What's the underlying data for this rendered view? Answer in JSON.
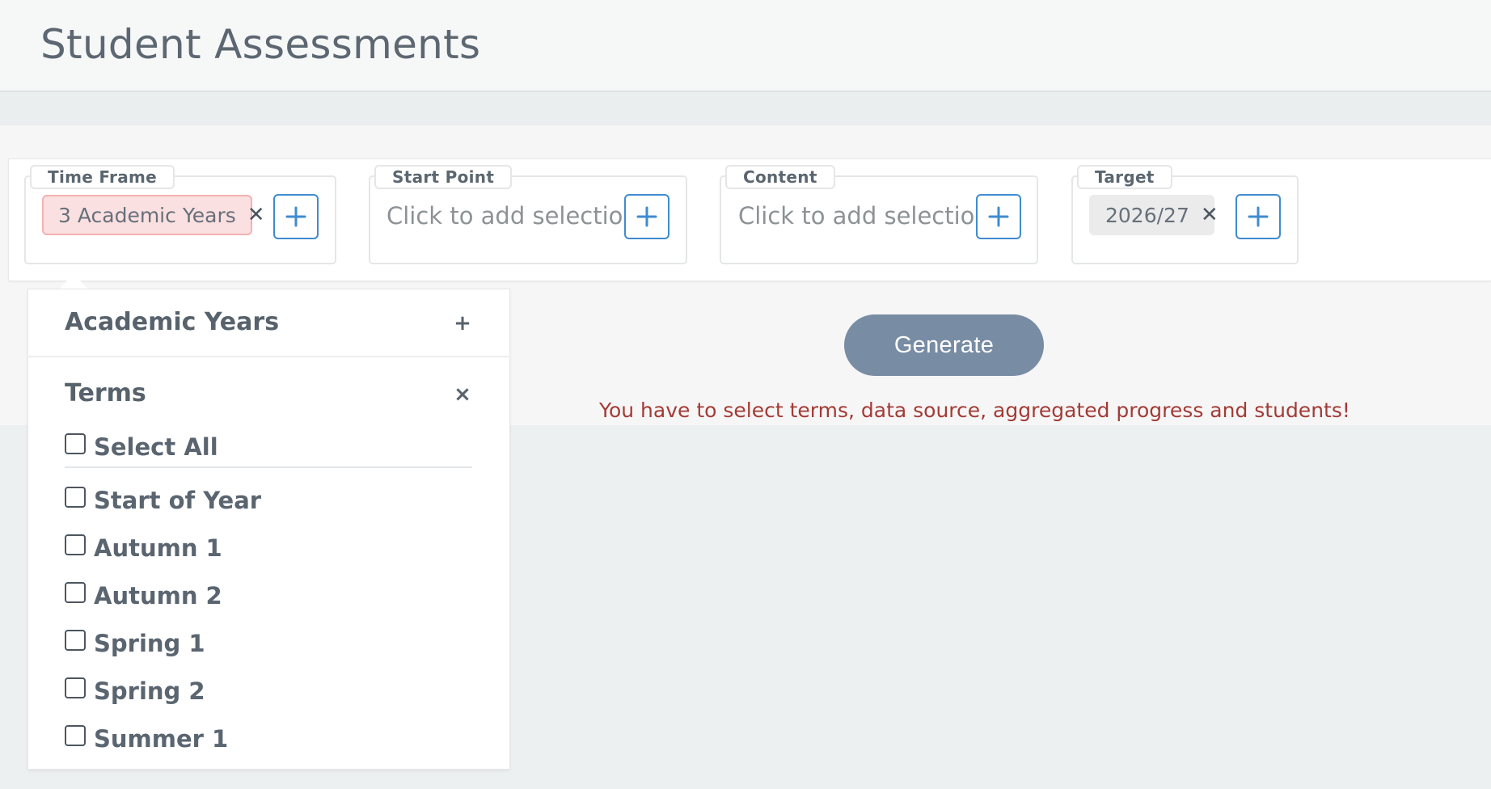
{
  "header": {
    "title": "Student Assessments"
  },
  "filters": [
    {
      "legend": "Time Frame",
      "chip": {
        "label": "3 Academic Years",
        "remove": "✕"
      },
      "add_label": "+"
    },
    {
      "legend": "Start Point",
      "placeholder": "Click to add selection",
      "add_label": "+"
    },
    {
      "legend": "Content",
      "placeholder": "Click to add selection",
      "add_label": "+"
    },
    {
      "legend": "Target",
      "chip": {
        "label": "2026/27",
        "remove": "✕"
      },
      "add_label": "+"
    }
  ],
  "actions": {
    "generate_label": "Generate",
    "error_message": "You have to select terms, data source, aggregated progress and students!"
  },
  "dropdown": {
    "sections": [
      {
        "title": "Academic Years",
        "toggle": "+"
      },
      {
        "title": "Terms",
        "toggle": "×"
      }
    ],
    "select_all": "Select All",
    "terms": [
      "Start of Year",
      "Autumn 1",
      "Autumn 2",
      "Spring 1",
      "Spring 2",
      "Summer 1"
    ]
  },
  "colors": {
    "accent": "#3f8bd0",
    "generate_button": "#788ca4",
    "error": "#a23b36",
    "chip_selected": "#fbe0e1"
  },
  "icons": {
    "add": "plus-icon",
    "remove": "close-icon"
  }
}
